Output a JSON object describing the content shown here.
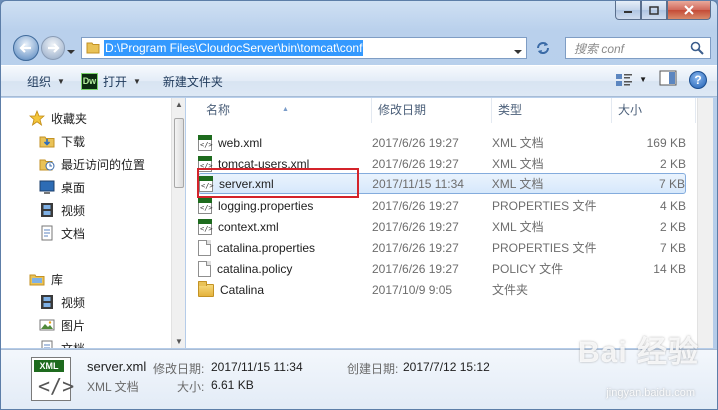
{
  "address": {
    "path": "D:\\Program Files\\CloudocServer\\bin\\tomcat\\conf"
  },
  "search": {
    "placeholder": "搜索 conf"
  },
  "toolbar": {
    "organize": "组织",
    "open": "打开",
    "new_folder": "新建文件夹"
  },
  "nav": {
    "favorites": "收藏夹",
    "downloads": "下载",
    "recent": "最近访问的位置",
    "desktop": "桌面",
    "videos": "视频",
    "documents": "文档",
    "libraries": "库",
    "lib_videos": "视频",
    "lib_pictures": "图片",
    "lib_documents": "文档"
  },
  "columns": {
    "name": "名称",
    "date": "修改日期",
    "type": "类型",
    "size": "大小"
  },
  "files": [
    {
      "name": "web.xml",
      "date": "2017/6/26 19:27",
      "type": "XML 文档",
      "size": "169 KB",
      "icon": "xml-file-icon"
    },
    {
      "name": "tomcat-users.xml",
      "date": "2017/6/26 19:27",
      "type": "XML 文档",
      "size": "2 KB",
      "icon": "xml-file-icon"
    },
    {
      "name": "server.xml",
      "date": "2017/11/15 11:34",
      "type": "XML 文档",
      "size": "7 KB",
      "icon": "xml-file-icon"
    },
    {
      "name": "logging.properties",
      "date": "2017/6/26 19:27",
      "type": "PROPERTIES 文件",
      "size": "4 KB",
      "icon": "xml-file-icon"
    },
    {
      "name": "context.xml",
      "date": "2017/6/26 19:27",
      "type": "XML 文档",
      "size": "2 KB",
      "icon": "xml-file-icon"
    },
    {
      "name": "catalina.properties",
      "date": "2017/6/26 19:27",
      "type": "PROPERTIES 文件",
      "size": "7 KB",
      "icon": "document-icon"
    },
    {
      "name": "catalina.policy",
      "date": "2017/6/26 19:27",
      "type": "POLICY 文件",
      "size": "14 KB",
      "icon": "document-icon"
    },
    {
      "name": "Catalina",
      "date": "2017/10/9 9:05",
      "type": "文件夹",
      "size": "",
      "icon": "folder-icon"
    }
  ],
  "details": {
    "filename": "server.xml",
    "filetype": "XML 文档",
    "modified_label": "修改日期:",
    "modified_value": "2017/11/15 11:34",
    "created_label": "创建日期:",
    "created_value": "2017/7/12 15:12",
    "size_label": "大小:",
    "size_value": "6.61 KB",
    "icon_badge": "XML"
  },
  "watermark": {
    "main": "Bai 经验",
    "sub": "jingyan.baidu.com"
  },
  "colors": {
    "selection": "#d6e8fb",
    "highlight_box": "#d4232a",
    "address_selection": "#3399ff"
  }
}
